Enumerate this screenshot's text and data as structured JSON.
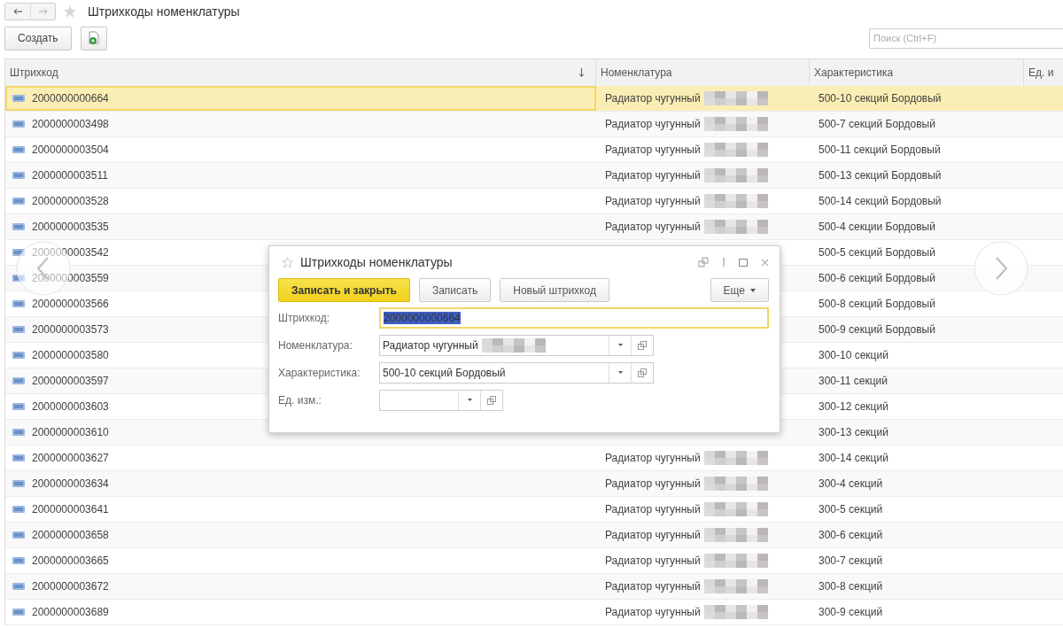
{
  "window": {
    "title": "Штрихкоды номенклатуры"
  },
  "toolbar": {
    "create_button": "Создать",
    "search": {
      "placeholder": "Поиск (Ctrl+F)"
    }
  },
  "table": {
    "columns": [
      {
        "label": "Штрихкод",
        "sorted": true
      },
      {
        "label": "Номенклатура",
        "sorted": false
      },
      {
        "label": "Характеристика",
        "sorted": false
      },
      {
        "label": "Ед. и",
        "sorted": false
      }
    ],
    "rows": [
      {
        "barcode": "2000000000664",
        "nomenclature": "Радиатор чугунный",
        "characteristic": "500-10 секций Бордовый",
        "selected": true
      },
      {
        "barcode": "2000000003498",
        "nomenclature": "Радиатор чугунный",
        "characteristic": "500-7 секций Бордовый",
        "selected": false
      },
      {
        "barcode": "2000000003504",
        "nomenclature": "Радиатор чугунный",
        "characteristic": "500-11 секций Бордовый",
        "selected": false
      },
      {
        "barcode": "2000000003511",
        "nomenclature": "Радиатор чугунный",
        "characteristic": "500-13 секций Бордовый",
        "selected": false
      },
      {
        "barcode": "2000000003528",
        "nomenclature": "Радиатор чугунный",
        "characteristic": "500-14 секций Бордовый",
        "selected": false
      },
      {
        "barcode": "2000000003535",
        "nomenclature": "Радиатор чугунный",
        "characteristic": "500-4 секции Бордовый",
        "selected": false
      },
      {
        "barcode": "2000000003542",
        "characteristic": "500-5 секций Бордовый",
        "selected": false
      },
      {
        "barcode": "2000000003559",
        "characteristic": "500-6 секций Бордовый",
        "selected": false
      },
      {
        "barcode": "2000000003566",
        "characteristic": "500-8 секций Бордовый",
        "selected": false
      },
      {
        "barcode": "2000000003573",
        "characteristic": "500-9 секций Бордовый",
        "selected": false
      },
      {
        "barcode": "2000000003580",
        "characteristic": "300-10 секций",
        "selected": false
      },
      {
        "barcode": "2000000003597",
        "characteristic": "300-11 секций",
        "selected": false
      },
      {
        "barcode": "2000000003603",
        "characteristic": "300-12 секций",
        "selected": false
      },
      {
        "barcode": "2000000003610",
        "characteristic": "300-13 секций",
        "selected": false
      },
      {
        "barcode": "2000000003627",
        "nomenclature": "Радиатор чугунный",
        "characteristic": "300-14 секций",
        "selected": false
      },
      {
        "barcode": "2000000003634",
        "nomenclature": "Радиатор чугунный",
        "characteristic": "300-4 секций",
        "selected": false
      },
      {
        "barcode": "2000000003641",
        "nomenclature": "Радиатор чугунный",
        "characteristic": "300-5 секций",
        "selected": false
      },
      {
        "barcode": "2000000003658",
        "nomenclature": "Радиатор чугунный",
        "characteristic": "300-6 секций",
        "selected": false
      },
      {
        "barcode": "2000000003665",
        "nomenclature": "Радиатор чугунный",
        "characteristic": "300-7 секций",
        "selected": false
      },
      {
        "barcode": "2000000003672",
        "nomenclature": "Радиатор чугунный",
        "characteristic": "300-8 секций",
        "selected": false
      },
      {
        "barcode": "2000000003689",
        "nomenclature": "Радиатор чугунный",
        "characteristic": "300-9 секций",
        "selected": false
      }
    ]
  },
  "dialog": {
    "title": "Штрихкоды номенклатуры",
    "buttons": [
      {
        "label": "Записать и закрыть",
        "default": true
      },
      {
        "label": "Записать",
        "default": false
      },
      {
        "label": "Новый штрихкод",
        "default": false
      }
    ],
    "more_button": "Еще",
    "fields": [
      {
        "kind": "text",
        "label": "Штрихкод:",
        "value": "2000000000664",
        "text_selected": true
      },
      {
        "kind": "combo",
        "label": "Номенклатура:",
        "value": "Радиатор чугунный",
        "redacted": true
      },
      {
        "kind": "combo",
        "label": "Характеристика:",
        "value": "500-10 секций Бордовый"
      },
      {
        "kind": "short",
        "label": "Ед. изм.:"
      }
    ]
  }
}
